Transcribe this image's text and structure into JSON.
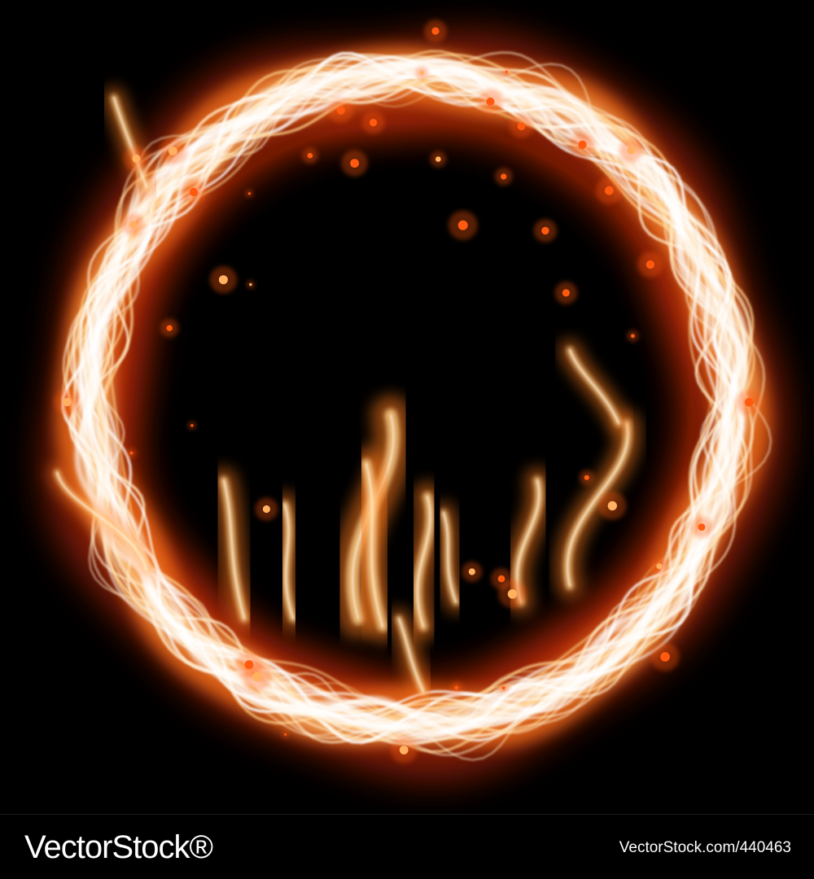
{
  "artwork": {
    "subject": "fire-ring",
    "colors": {
      "background": "#000000",
      "core": "#ffffff",
      "inner": "#ffd08a",
      "mid": "#ff7a1a",
      "outer": "#e0300a",
      "ember": "#ff5a10"
    }
  },
  "footer": {
    "logo_text": "VectorStock®",
    "image_ref": "VectorStock.com/440463"
  }
}
